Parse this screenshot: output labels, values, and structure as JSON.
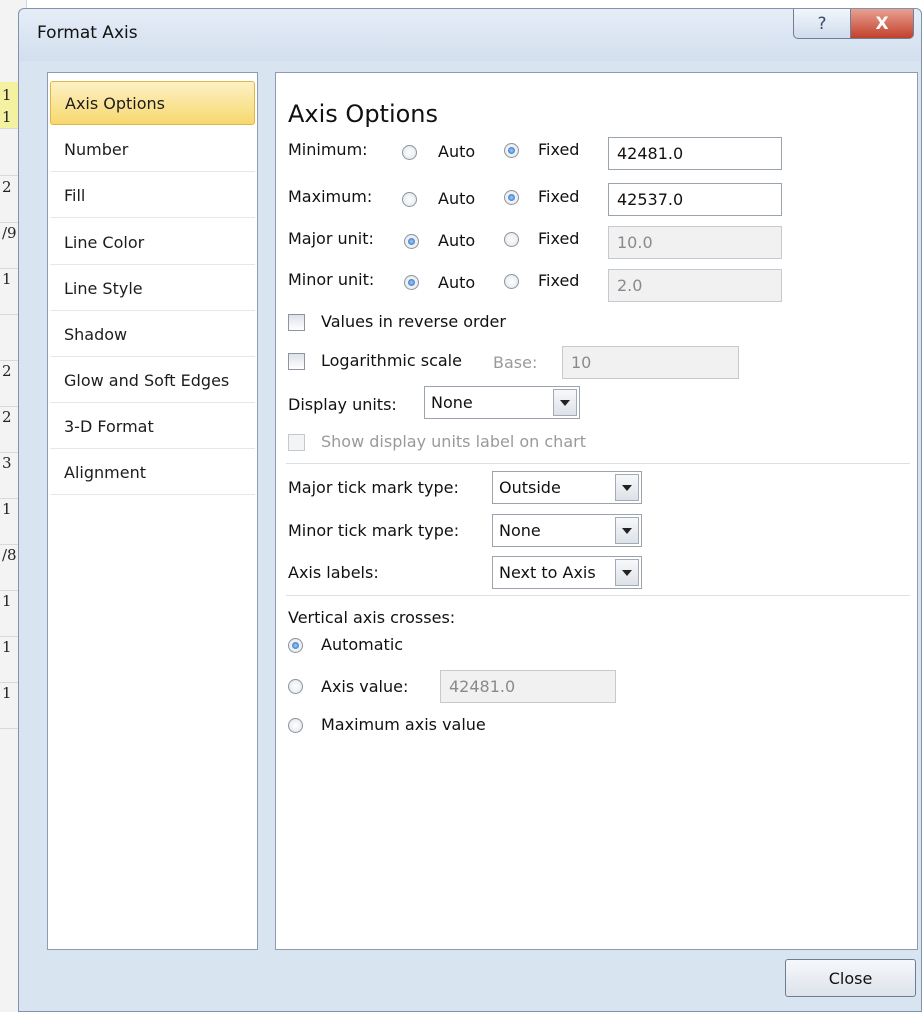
{
  "background": {
    "row_numbers": [
      "1",
      "1",
      "2",
      "/9",
      "1",
      "2",
      "2",
      "3",
      "1",
      "/8",
      "1",
      "1",
      "1"
    ]
  },
  "dialog": {
    "title": "Format Axis",
    "help_symbol": "?",
    "close_symbol": "X",
    "close_button": "Close"
  },
  "nav": {
    "items": [
      "Axis Options",
      "Number",
      "Fill",
      "Line Color",
      "Line Style",
      "Shadow",
      "Glow and Soft Edges",
      "3-D Format",
      "Alignment"
    ],
    "selected": "Axis Options"
  },
  "panel": {
    "title": "Axis Options",
    "minimum": {
      "label": "Minimum:",
      "mode": "Fixed",
      "auto_label": "Auto",
      "fixed_label": "Fixed",
      "value": "42481.0"
    },
    "maximum": {
      "label": "Maximum:",
      "mode": "Fixed",
      "auto_label": "Auto",
      "fixed_label": "Fixed",
      "value": "42537.0"
    },
    "major_unit": {
      "label": "Major unit:",
      "mode": "Auto",
      "auto_label": "Auto",
      "fixed_label": "Fixed",
      "value": "10.0"
    },
    "minor_unit": {
      "label": "Minor unit:",
      "mode": "Auto",
      "auto_label": "Auto",
      "fixed_label": "Fixed",
      "value": "2.0"
    },
    "reverse_order": {
      "label": "Values in reverse order",
      "checked": false
    },
    "log_scale": {
      "label": "Logarithmic scale",
      "checked": false,
      "base_label": "Base:",
      "base_value": "10"
    },
    "display_units": {
      "label": "Display units:",
      "value": "None"
    },
    "show_units_label": {
      "label": "Show display units label on chart",
      "checked": false
    },
    "major_tick": {
      "label": "Major tick mark type:",
      "value": "Outside"
    },
    "minor_tick": {
      "label": "Minor tick mark type:",
      "value": "None"
    },
    "axis_labels": {
      "label": "Axis labels:",
      "value": "Next to Axis"
    },
    "crosses": {
      "heading": "Vertical axis crosses:",
      "automatic_label": "Automatic",
      "axis_value_label": "Axis value:",
      "axis_value": "42481.0",
      "max_label": "Maximum axis value",
      "selected": "Automatic"
    }
  }
}
